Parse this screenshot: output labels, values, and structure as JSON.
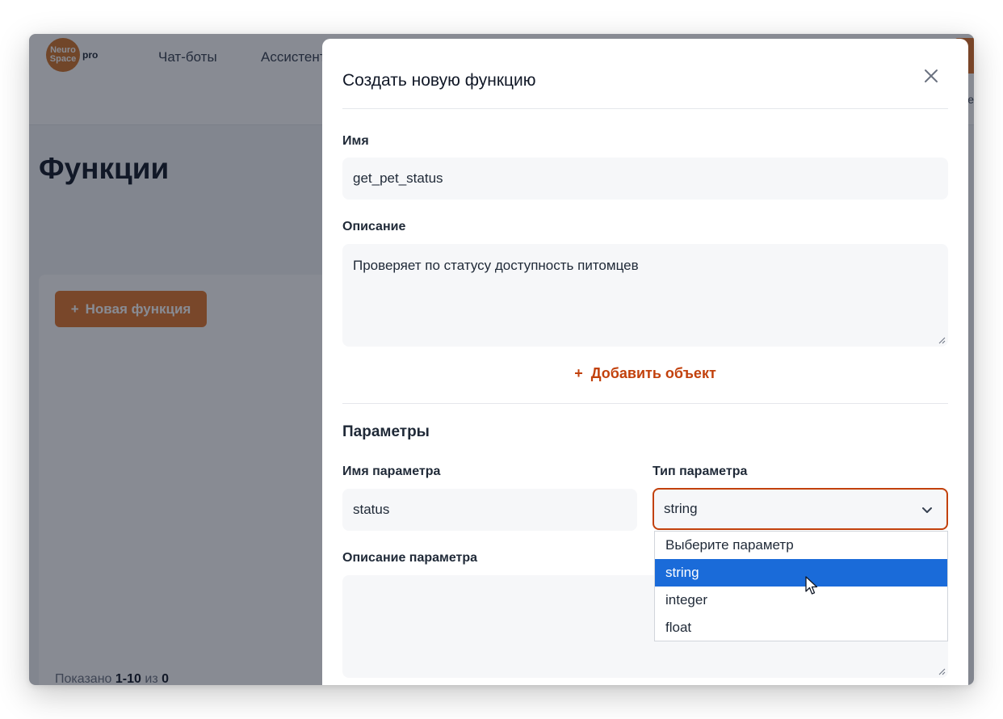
{
  "app": {
    "logo_line1": "Neuro",
    "logo_line2": "Space",
    "logo_suffix": "pro",
    "nav": [
      "Чат-боты",
      "Ассистенты"
    ],
    "header_right_fragment": "е",
    "page_title": "Функции",
    "new_function_button": "Новая функция",
    "shown_prefix": "Показано",
    "shown_range": "1-10",
    "shown_of": "из",
    "shown_total": "0",
    "accent_color": "#e0772d"
  },
  "modal": {
    "title": "Создать новую функцию",
    "name_label": "Имя",
    "name_value": "get_pet_status",
    "description_label": "Описание",
    "description_value": "Проверяет по статусу доступность питомцев",
    "add_object_label": "Добавить объект",
    "params_section_title": "Параметры",
    "param_name_label": "Имя параметра",
    "param_name_value": "status",
    "param_type_label": "Тип параметра",
    "param_type_value": "string",
    "param_description_label": "Описание параметра",
    "param_description_value": "",
    "type_options": [
      "Выберите параметр",
      "string",
      "integer",
      "float"
    ],
    "selected_option": "string"
  }
}
